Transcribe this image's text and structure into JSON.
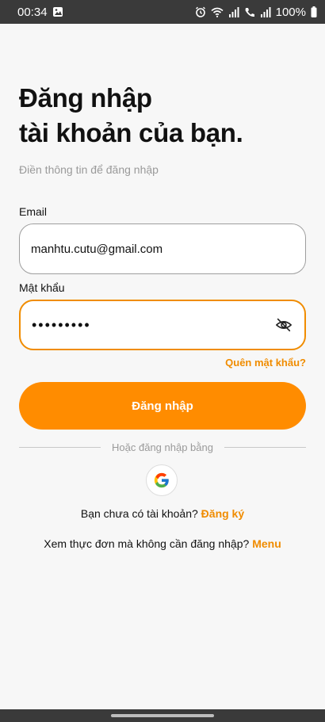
{
  "status_bar": {
    "time": "00:34",
    "battery": "100%"
  },
  "page": {
    "title_line1": "Đăng nhập",
    "title_line2": "tài khoản của bạn.",
    "subtitle": "Điền thông tin để đăng nhập"
  },
  "form": {
    "email_label": "Email",
    "email_value": "manhtu.cutu@gmail.com",
    "password_label": "Mật khẩu",
    "password_value": "•••••••••",
    "forgot_label": "Quên mật khẩu?",
    "login_label": "Đăng nhập",
    "divider_text": "Hoặc đăng nhập bằng"
  },
  "footer": {
    "signup_prompt": "Bạn chưa có tài khoản? ",
    "signup_link": "Đăng ký",
    "menu_prompt": "Xem thực đơn mà không cần đăng nhập? ",
    "menu_link": "Menu"
  },
  "icons": {
    "google": "google-icon",
    "eye": "eye-off-icon",
    "gallery": "image-icon",
    "alarm": "alarm-icon",
    "wifi": "wifi-icon",
    "signal": "signal-icon",
    "battery": "battery-icon"
  },
  "colors": {
    "accent": "#ff8c00",
    "link": "#f08c00",
    "background": "#f7f7f7"
  }
}
